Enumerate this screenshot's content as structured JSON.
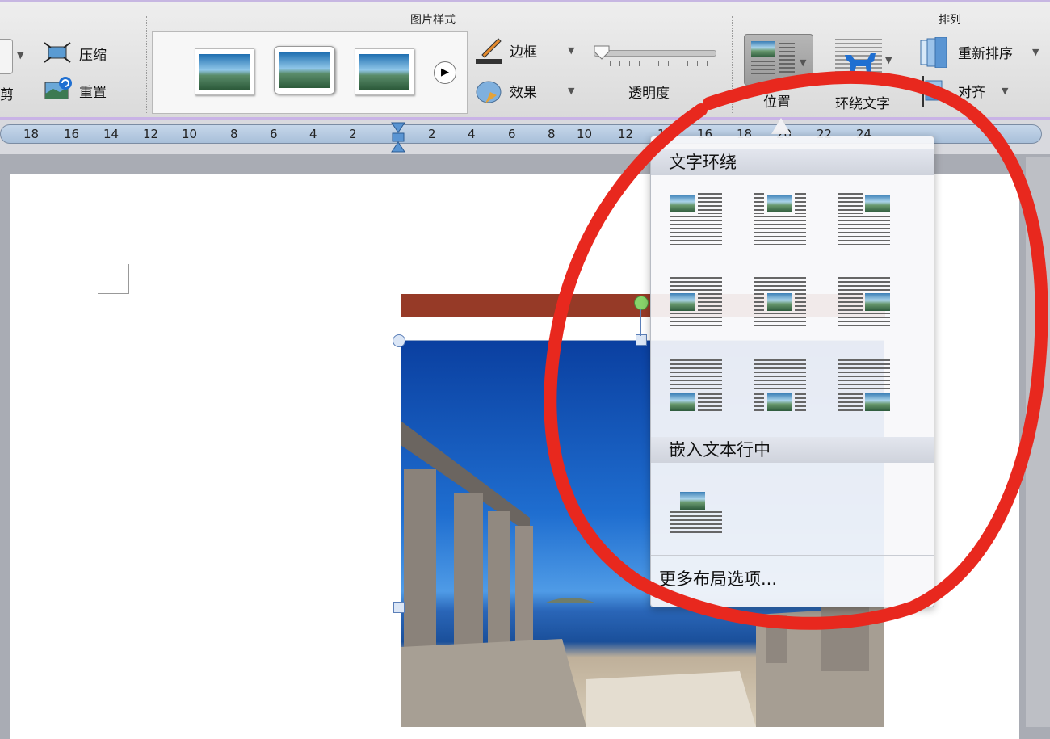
{
  "ribbon": {
    "picture_style_title": "图片样式",
    "arrange_title": "排列",
    "compress_label": "压缩",
    "reset_label": "重置",
    "crop_partial_label": "剪",
    "border_label": "边框",
    "effects_label": "效果",
    "transparency_label": "透明度",
    "position_label": "位置",
    "wrap_text_label": "环绕文字",
    "reorder_label": "重新排序",
    "align_label": "对齐"
  },
  "ruler": {
    "ticks": [
      "18",
      "16",
      "14",
      "12",
      "10",
      "8",
      "6",
      "4",
      "2",
      "2",
      "4",
      "6",
      "8",
      "10",
      "12",
      "14",
      "16",
      "18",
      "20",
      "22",
      "24"
    ]
  },
  "dropdown": {
    "wrap_section_title": "文字环绕",
    "inline_section_title": "嵌入文本行中",
    "more_layout_label": "更多布局选项..."
  },
  "colors": {
    "annotation": "#e8281e",
    "ribbon_accent": "#c9b3e6",
    "title_bar": "#963a27"
  }
}
